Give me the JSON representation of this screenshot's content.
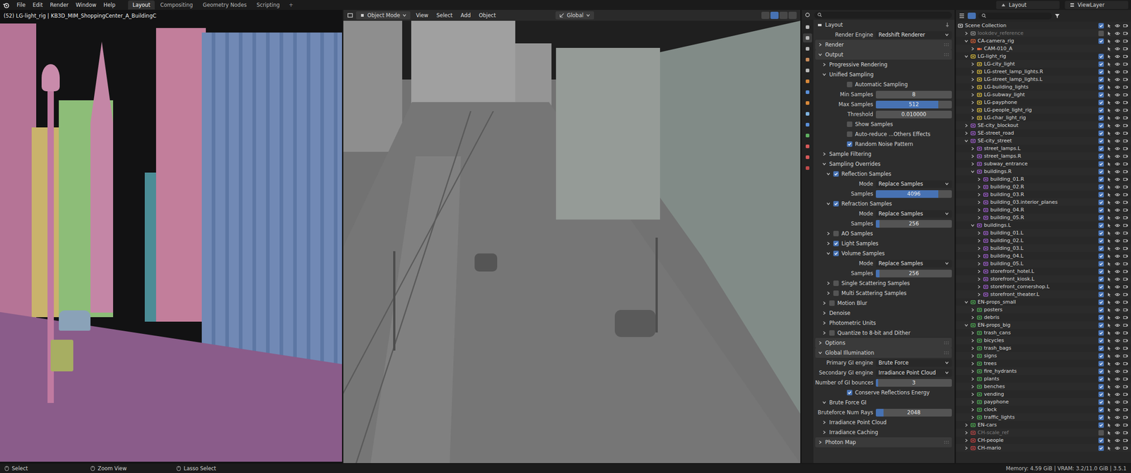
{
  "topbar": {
    "menus": [
      "File",
      "Edit",
      "Render",
      "Window",
      "Help"
    ],
    "workspaces": [
      {
        "label": "Layout",
        "selected": true
      },
      {
        "label": "Compositing",
        "selected": false
      },
      {
        "label": "Geometry Nodes",
        "selected": false
      },
      {
        "label": "Scripting",
        "selected": false
      }
    ],
    "add_tab": "+",
    "scene": "Layout",
    "view_layer": "ViewLayer"
  },
  "left_viewport": {
    "label": "(52) LG-light_rig | KB3D_MIM_ShoppingCenter_A_BuildingC"
  },
  "main_viewport": {
    "mode": "Object Mode",
    "menus": [
      "View",
      "Select",
      "Add",
      "Object"
    ],
    "orientation": "Global"
  },
  "properties": {
    "context": "Layout",
    "rows": [
      {
        "kind": "dropdown",
        "label": "Render Engine",
        "value": "Redshift Renderer"
      },
      {
        "kind": "header",
        "depth": 0,
        "expanded": false,
        "label": "Render"
      },
      {
        "kind": "header",
        "depth": 0,
        "expanded": true,
        "label": "Output"
      },
      {
        "kind": "header",
        "depth": 1,
        "expanded": false,
        "label": "Progressive Rendering"
      },
      {
        "kind": "header",
        "depth": 1,
        "expanded": true,
        "label": "Unified Sampling"
      },
      {
        "kind": "checkbox",
        "label": "Automatic Sampling",
        "checked": false
      },
      {
        "kind": "number",
        "label": "Min Samples",
        "value": "8"
      },
      {
        "kind": "slider",
        "label": "Max Samples",
        "value": "512",
        "level": 0.82
      },
      {
        "kind": "number",
        "label": "Threshold",
        "value": "0.010000"
      },
      {
        "kind": "checkbox",
        "label": "Show Samples",
        "checked": false
      },
      {
        "kind": "checkbox",
        "label": "Auto-reduce ...Others Effects",
        "checked": false
      },
      {
        "kind": "checkbox",
        "label": "Random Noise Pattern",
        "checked": true
      },
      {
        "kind": "header",
        "depth": 1,
        "expanded": false,
        "label": "Sample Filtering"
      },
      {
        "kind": "header",
        "depth": 1,
        "expanded": true,
        "label": "Sampling Overrides"
      },
      {
        "kind": "check-header",
        "depth": 2,
        "expanded": true,
        "checked": true,
        "label": "Reflection Samples"
      },
      {
        "kind": "dropdown",
        "label": "Mode",
        "value": "Replace Samples"
      },
      {
        "kind": "slider",
        "label": "Samples",
        "value": "4096",
        "level": 0.82
      },
      {
        "kind": "check-header",
        "depth": 2,
        "expanded": true,
        "checked": true,
        "label": "Refraction Samples"
      },
      {
        "kind": "dropdown",
        "label": "Mode",
        "value": "Replace Samples"
      },
      {
        "kind": "slider",
        "label": "Samples",
        "value": "256",
        "level": 0.05
      },
      {
        "kind": "check-header",
        "depth": 2,
        "expanded": false,
        "checked": false,
        "label": "AO Samples"
      },
      {
        "kind": "check-header",
        "depth": 2,
        "expanded": false,
        "checked": true,
        "label": "Light Samples"
      },
      {
        "kind": "check-header",
        "depth": 2,
        "expanded": true,
        "checked": true,
        "label": "Volume Samples"
      },
      {
        "kind": "dropdown",
        "label": "Mode",
        "value": "Replace Samples"
      },
      {
        "kind": "slider",
        "label": "Samples",
        "value": "256",
        "level": 0.05
      },
      {
        "kind": "check-header",
        "depth": 2,
        "expanded": false,
        "checked": false,
        "label": "Single Scattering Samples"
      },
      {
        "kind": "check-header",
        "depth": 2,
        "expanded": false,
        "checked": false,
        "label": "Multi Scattering Samples"
      },
      {
        "kind": "check-header",
        "depth": 1,
        "expanded": false,
        "checked": false,
        "label": "Motion Blur"
      },
      {
        "kind": "header",
        "depth": 1,
        "expanded": false,
        "label": "Denoise"
      },
      {
        "kind": "header",
        "depth": 1,
        "expanded": false,
        "label": "Photometric Units"
      },
      {
        "kind": "check-header",
        "depth": 1,
        "expanded": false,
        "checked": false,
        "label": "Quantize to 8-bit and Dither"
      },
      {
        "kind": "header",
        "depth": 0,
        "expanded": false,
        "label": "Options"
      },
      {
        "kind": "header",
        "depth": 0,
        "expanded": true,
        "label": "Global Illumination"
      },
      {
        "kind": "dropdown",
        "label": "Primary GI engine",
        "value": "Brute Force"
      },
      {
        "kind": "dropdown",
        "label": "Secondary GI engine",
        "value": "Irradiance Point Cloud"
      },
      {
        "kind": "slider",
        "label": "Number of GI bounces",
        "value": "3",
        "level": 0.03
      },
      {
        "kind": "checkbox",
        "label": "Conserve Reflections Energy",
        "checked": true
      },
      {
        "kind": "header",
        "depth": 1,
        "expanded": true,
        "label": "Brute Force GI"
      },
      {
        "kind": "slider",
        "label": "Bruteforce Num Rays",
        "value": "2048",
        "level": 0.1
      },
      {
        "kind": "header",
        "depth": 1,
        "expanded": false,
        "label": "Irradiance Point Cloud"
      },
      {
        "kind": "header",
        "depth": 1,
        "expanded": false,
        "label": "Irradiance Caching"
      },
      {
        "kind": "header",
        "depth": 0,
        "expanded": false,
        "label": "Photon Map"
      }
    ]
  },
  "outliner": {
    "items": [
      {
        "name": "Scene Collection",
        "depth": 0,
        "kind": "scene",
        "expanded": true,
        "color": "#cfcfcf",
        "enabled": true
      },
      {
        "name": "lookdev_reference",
        "depth": 1,
        "kind": "collection",
        "expanded": false,
        "color": "#9a9a9a",
        "enabled": false
      },
      {
        "name": "CA-camera_rig",
        "depth": 1,
        "kind": "collection",
        "expanded": true,
        "color": "#e0643a",
        "enabled": true
      },
      {
        "name": "CAM-010_A",
        "depth": 2,
        "kind": "object",
        "expanded": false,
        "color": "#e0643a",
        "enabled": true
      },
      {
        "name": "LG-light_rig",
        "depth": 1,
        "kind": "collection",
        "expanded": true,
        "color": "#e2c23c",
        "enabled": true
      },
      {
        "name": "LG-city_light",
        "depth": 2,
        "kind": "collection",
        "expanded": false,
        "color": "#e2c23c",
        "enabled": true
      },
      {
        "name": "LG-street_lamp_lights.R",
        "depth": 2,
        "kind": "collection",
        "expanded": false,
        "color": "#e2c23c",
        "enabled": true
      },
      {
        "name": "LG-street_lamp_lights.L",
        "depth": 2,
        "kind": "collection",
        "expanded": false,
        "color": "#e2c23c",
        "enabled": true
      },
      {
        "name": "LG-building_lights",
        "depth": 2,
        "kind": "collection",
        "expanded": false,
        "color": "#e2c23c",
        "enabled": true
      },
      {
        "name": "LG-subway_light",
        "depth": 2,
        "kind": "collection",
        "expanded": false,
        "color": "#e2c23c",
        "enabled": true
      },
      {
        "name": "LG-payphone",
        "depth": 2,
        "kind": "collection",
        "expanded": false,
        "color": "#e2c23c",
        "enabled": true
      },
      {
        "name": "LG-people_light_rig",
        "depth": 2,
        "kind": "collection",
        "expanded": false,
        "color": "#e2c23c",
        "enabled": true
      },
      {
        "name": "LG-char_light_rig",
        "depth": 2,
        "kind": "collection",
        "expanded": false,
        "color": "#e2c23c",
        "enabled": true
      },
      {
        "name": "SE-city_blockout",
        "depth": 1,
        "kind": "collection",
        "expanded": false,
        "color": "#a45fd6",
        "enabled": true
      },
      {
        "name": "SE-street_road",
        "depth": 1,
        "kind": "collection",
        "expanded": false,
        "color": "#a45fd6",
        "enabled": true
      },
      {
        "name": "SE-city_street",
        "depth": 1,
        "kind": "collection",
        "expanded": true,
        "color": "#a45fd6",
        "enabled": true
      },
      {
        "name": "street_lamps.L",
        "depth": 2,
        "kind": "collection",
        "expanded": false,
        "color": "#a45fd6",
        "enabled": true
      },
      {
        "name": "street_lamps.R",
        "depth": 2,
        "kind": "collection",
        "expanded": false,
        "color": "#a45fd6",
        "enabled": true
      },
      {
        "name": "subway_entrance",
        "depth": 2,
        "kind": "collection",
        "expanded": false,
        "color": "#a45fd6",
        "enabled": true
      },
      {
        "name": "buildings.R",
        "depth": 2,
        "kind": "collection",
        "expanded": true,
        "color": "#a45fd6",
        "enabled": true
      },
      {
        "name": "building_01.R",
        "depth": 3,
        "kind": "collection",
        "expanded": false,
        "color": "#a45fd6",
        "enabled": true
      },
      {
        "name": "building_02.R",
        "depth": 3,
        "kind": "collection",
        "expanded": false,
        "color": "#a45fd6",
        "enabled": true
      },
      {
        "name": "building_03.R",
        "depth": 3,
        "kind": "collection",
        "expanded": false,
        "color": "#a45fd6",
        "enabled": true
      },
      {
        "name": "building_03.interior_planes",
        "depth": 3,
        "kind": "collection",
        "expanded": false,
        "color": "#a45fd6",
        "enabled": true
      },
      {
        "name": "building_04.R",
        "depth": 3,
        "kind": "collection",
        "expanded": false,
        "color": "#a45fd6",
        "enabled": true
      },
      {
        "name": "building_05.R",
        "depth": 3,
        "kind": "collection",
        "expanded": false,
        "color": "#a45fd6",
        "enabled": true
      },
      {
        "name": "buildings.L",
        "depth": 2,
        "kind": "collection",
        "expanded": true,
        "color": "#a45fd6",
        "enabled": true
      },
      {
        "name": "building_01.L",
        "depth": 3,
        "kind": "collection",
        "expanded": false,
        "color": "#a45fd6",
        "enabled": true
      },
      {
        "name": "building_02.L",
        "depth": 3,
        "kind": "collection",
        "expanded": false,
        "color": "#a45fd6",
        "enabled": true
      },
      {
        "name": "building_03.L",
        "depth": 3,
        "kind": "collection",
        "expanded": false,
        "color": "#a45fd6",
        "enabled": true
      },
      {
        "name": "building_04.L",
        "depth": 3,
        "kind": "collection",
        "expanded": false,
        "color": "#a45fd6",
        "enabled": true
      },
      {
        "name": "building_05.L",
        "depth": 3,
        "kind": "collection",
        "expanded": false,
        "color": "#a45fd6",
        "enabled": true
      },
      {
        "name": "storefront_hotel.L",
        "depth": 3,
        "kind": "collection",
        "expanded": false,
        "color": "#a45fd6",
        "enabled": true
      },
      {
        "name": "storefront_kiosk.L",
        "depth": 3,
        "kind": "collection",
        "expanded": false,
        "color": "#a45fd6",
        "enabled": true
      },
      {
        "name": "storefront_cornershop.L",
        "depth": 3,
        "kind": "collection",
        "expanded": false,
        "color": "#a45fd6",
        "enabled": true
      },
      {
        "name": "storefront_theater.L",
        "depth": 3,
        "kind": "collection",
        "expanded": false,
        "color": "#a45fd6",
        "enabled": true
      },
      {
        "name": "EN-props_small",
        "depth": 1,
        "kind": "collection",
        "expanded": true,
        "color": "#4fb356",
        "enabled": true
      },
      {
        "name": "posters",
        "depth": 2,
        "kind": "collection",
        "expanded": false,
        "color": "#4fb356",
        "enabled": true
      },
      {
        "name": "debris",
        "depth": 2,
        "kind": "collection",
        "expanded": false,
        "color": "#4fb356",
        "enabled": true
      },
      {
        "name": "EN-props_big",
        "depth": 1,
        "kind": "collection",
        "expanded": true,
        "color": "#4fb356",
        "enabled": true
      },
      {
        "name": "trash_cans",
        "depth": 2,
        "kind": "collection",
        "expanded": false,
        "color": "#4fb356",
        "enabled": true
      },
      {
        "name": "bicycles",
        "depth": 2,
        "kind": "collection",
        "expanded": false,
        "color": "#4fb356",
        "enabled": true
      },
      {
        "name": "trash_bags",
        "depth": 2,
        "kind": "collection",
        "expanded": false,
        "color": "#4fb356",
        "enabled": true
      },
      {
        "name": "signs",
        "depth": 2,
        "kind": "collection",
        "expanded": false,
        "color": "#4fb356",
        "enabled": true
      },
      {
        "name": "trees",
        "depth": 2,
        "kind": "collection",
        "expanded": false,
        "color": "#4fb356",
        "enabled": true
      },
      {
        "name": "fire_hydrants",
        "depth": 2,
        "kind": "collection",
        "expanded": false,
        "color": "#4fb356",
        "enabled": true
      },
      {
        "name": "plants",
        "depth": 2,
        "kind": "collection",
        "expanded": false,
        "color": "#4fb356",
        "enabled": true
      },
      {
        "name": "benches",
        "depth": 2,
        "kind": "collection",
        "expanded": false,
        "color": "#4fb356",
        "enabled": true
      },
      {
        "name": "vending",
        "depth": 2,
        "kind": "collection",
        "expanded": false,
        "color": "#4fb356",
        "enabled": true
      },
      {
        "name": "payphone",
        "depth": 2,
        "kind": "collection",
        "expanded": false,
        "color": "#4fb356",
        "enabled": true
      },
      {
        "name": "clock",
        "depth": 2,
        "kind": "collection",
        "expanded": false,
        "color": "#4fb356",
        "enabled": true
      },
      {
        "name": "traffic_lights",
        "depth": 2,
        "kind": "collection",
        "expanded": false,
        "color": "#4fb356",
        "enabled": true
      },
      {
        "name": "EN-cars",
        "depth": 1,
        "kind": "collection",
        "expanded": false,
        "color": "#4fb356",
        "enabled": true
      },
      {
        "name": "CH-scale_ref",
        "depth": 1,
        "kind": "collection",
        "expanded": false,
        "color": "#c04848",
        "enabled": false
      },
      {
        "name": "CH-people",
        "depth": 1,
        "kind": "collection",
        "expanded": false,
        "color": "#d04545",
        "enabled": true
      },
      {
        "name": "CH-mario",
        "depth": 1,
        "kind": "collection",
        "expanded": false,
        "color": "#d04545",
        "enabled": true
      }
    ]
  },
  "status_bar": {
    "hints": [
      "Select",
      "Zoom View",
      "Lasso Select"
    ],
    "info": "Memory: 4.59 GiB | VRAM: 3.2/11.0 GiB | 3.5.1"
  }
}
